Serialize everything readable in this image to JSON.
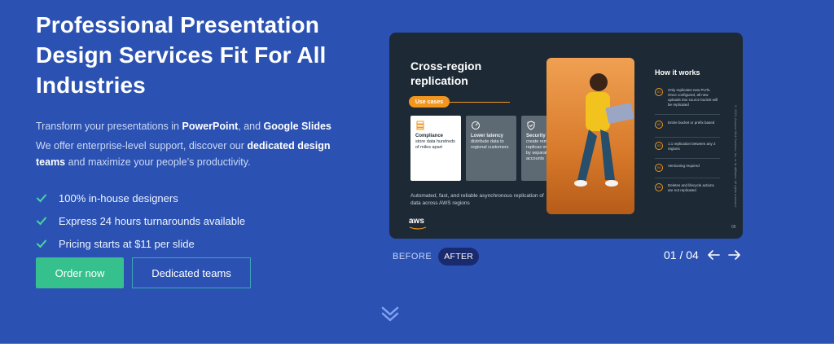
{
  "hero": {
    "title_line1": "Professional Presentation",
    "title_line2": "Design Services Fit For All",
    "title_line3": "Industries",
    "subtitle_part1": "Transform your presentations in ",
    "subtitle_bold1": "PowerPoint",
    "subtitle_part2": ", and ",
    "subtitle_bold2": "Google Slides",
    "subtitle2_part1": "We offer enterprise-level support, discover our ",
    "subtitle2_bold": "dedicated design teams",
    "subtitle2_part2": " and maximize your people’s productivity.",
    "checks": [
      "100% in-house designers",
      "Express 24 hours turnarounds available",
      "Pricing starts at $11 per slide"
    ],
    "order_button": "Order now",
    "teams_button": "Dedicated teams"
  },
  "slide": {
    "title_line1": "Cross-region",
    "title_line2": "replication",
    "pill": "Use cases",
    "cards": [
      {
        "title": "Compliance",
        "text": "store data hundreds of miles apart"
      },
      {
        "title": "Lower latency",
        "text": "distribute data to regional customers"
      },
      {
        "title": "Security",
        "text": "create remote replicas managed by separate AWS accounts"
      }
    ],
    "footer": "Automated, fast, and reliable asynchronous replication of data across AWS regions",
    "aws": "aws",
    "how_title": "How it works",
    "how_items": [
      {
        "num": "01",
        "text": "Only replicates new PUTs. Once configured, all new uploads into source bucket will be replicated"
      },
      {
        "num": "02",
        "text": "Entire bucket or prefix based"
      },
      {
        "num": "03",
        "text": "1:1 replication between any 2 regions"
      },
      {
        "num": "04",
        "text": "Versioning required"
      },
      {
        "num": "05",
        "text": "Deletes and lifecycle actions are not replicated"
      }
    ],
    "page_num": "05",
    "vertical_note": "© 2023, Amazon Web Services, Inc. or its affiliates. All rights reserved."
  },
  "slider": {
    "before": "BEFORE",
    "after": "AFTER",
    "counter": "01 / 04"
  },
  "colors": {
    "background": "#2b52b3",
    "primary_button": "#36c08e",
    "check": "#46d6a0",
    "accent_orange": "#f2961e"
  }
}
